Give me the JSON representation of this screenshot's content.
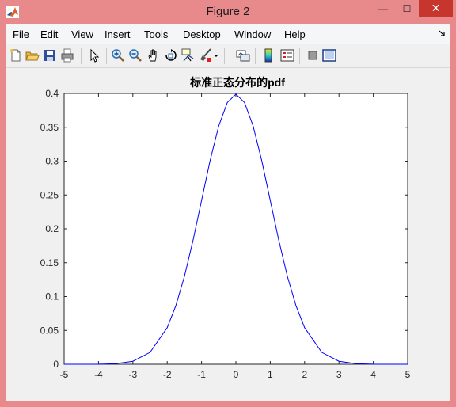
{
  "window": {
    "title": "Figure 2",
    "min_glyph": "—",
    "max_glyph": "☐",
    "close_glyph": "✕"
  },
  "menu": {
    "items": [
      "File",
      "Edit",
      "View",
      "Insert",
      "Tools",
      "Desktop",
      "Window",
      "Help"
    ]
  },
  "toolbar": {
    "buttons": [
      "new-figure",
      "open-file",
      "save-figure",
      "print-figure",
      "edit-plot",
      "zoom-in",
      "zoom-out",
      "pan",
      "rotate-3d",
      "data-cursor",
      "brush",
      "brush-menu",
      "link-plot",
      "insert-colorbar",
      "insert-legend",
      "hide-plot-tools",
      "show-plot-tools"
    ]
  },
  "chart_data": {
    "type": "line",
    "title": "标准正态分布的pdf",
    "xlabel": "",
    "ylabel": "",
    "xlim": [
      -5,
      5
    ],
    "ylim": [
      0,
      0.4
    ],
    "xticks": [
      "-5",
      "-4",
      "-3",
      "-2",
      "-1",
      "0",
      "1",
      "2",
      "3",
      "4",
      "5"
    ],
    "yticks": [
      "0",
      "0.05",
      "0.1",
      "0.15",
      "0.2",
      "0.25",
      "0.3",
      "0.35",
      "0.4"
    ],
    "grid": false,
    "color": "#0000ff",
    "series": [
      {
        "x": [
          -5,
          -4.5,
          -4,
          -3.5,
          -3,
          -2.5,
          -2,
          -1.75,
          -1.5,
          -1.25,
          -1,
          -0.75,
          -0.5,
          -0.25,
          0,
          0.25,
          0.5,
          0.75,
          1,
          1.25,
          1.5,
          1.75,
          2,
          2.5,
          3,
          3.5,
          4,
          4.5,
          5
        ],
        "y": [
          1.5e-06,
          1.6e-05,
          0.000134,
          0.000873,
          0.004432,
          0.017528,
          0.053991,
          0.086277,
          0.129518,
          0.182649,
          0.241971,
          0.301137,
          0.352065,
          0.386668,
          0.398942,
          0.386668,
          0.352065,
          0.301137,
          0.241971,
          0.182649,
          0.129518,
          0.086277,
          0.053991,
          0.017528,
          0.004432,
          0.000873,
          0.000134,
          1.6e-05,
          1.5e-06
        ]
      }
    ]
  }
}
